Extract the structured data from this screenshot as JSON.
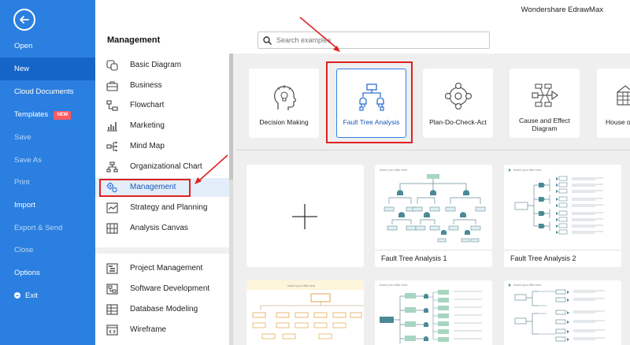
{
  "app": {
    "title": "Wondershare EdrawMax"
  },
  "menu": {
    "items": [
      {
        "label": "Open"
      },
      {
        "label": "New"
      },
      {
        "label": "Cloud Documents"
      },
      {
        "label": "Templates",
        "badge": "NEW"
      },
      {
        "label": "Save"
      },
      {
        "label": "Save As"
      },
      {
        "label": "Print"
      },
      {
        "label": "Import"
      },
      {
        "label": "Export & Send"
      },
      {
        "label": "Close"
      },
      {
        "label": "Options"
      },
      {
        "label": "Exit"
      }
    ]
  },
  "header": {
    "section_title": "Management"
  },
  "search": {
    "placeholder": "Search examples"
  },
  "categories": {
    "items": [
      {
        "label": "Basic Diagram",
        "icon": "basic-diagram-icon"
      },
      {
        "label": "Business",
        "icon": "briefcase-icon"
      },
      {
        "label": "Flowchart",
        "icon": "flowchart-icon"
      },
      {
        "label": "Marketing",
        "icon": "bar-chart-icon"
      },
      {
        "label": "Mind Map",
        "icon": "mind-map-icon"
      },
      {
        "label": "Organizational Chart",
        "icon": "org-chart-icon"
      },
      {
        "label": "Management",
        "icon": "management-gear-icon"
      },
      {
        "label": "Strategy and Planning",
        "icon": "strategy-icon"
      },
      {
        "label": "Analysis Canvas",
        "icon": "canvas-icon"
      },
      {
        "label": "Project Management",
        "icon": "gantt-icon"
      },
      {
        "label": "Software Development",
        "icon": "software-icon"
      },
      {
        "label": "Database Modeling",
        "icon": "database-icon"
      },
      {
        "label": "Wireframe",
        "icon": "wireframe-icon"
      }
    ]
  },
  "diagram_types": {
    "items": [
      {
        "label": "Decision Making",
        "icon": "head-bulb-icon"
      },
      {
        "label": "Fault Tree Analysis",
        "icon": "fault-tree-icon"
      },
      {
        "label": "Plan-Do-Check-Act",
        "icon": "pdca-cycle-icon"
      },
      {
        "label": "Cause and Effect Diagram",
        "icon": "fishbone-icon"
      },
      {
        "label": "House o",
        "icon": "house-of-quality-icon"
      }
    ]
  },
  "templates": {
    "items": [
      {
        "name": "Fault Tree Analysis 1",
        "thumb_title": "Insert your title here"
      },
      {
        "name": "Fault Tree Analysis 2",
        "thumb_title": "Insert your title here"
      },
      {
        "name": "",
        "thumb_title": "Insert your title here"
      },
      {
        "name": "",
        "thumb_title": "Insert your title here"
      },
      {
        "name": "",
        "thumb_title": "Insert your title here"
      }
    ]
  },
  "colors": {
    "menu_blue": "#2a7fe0",
    "selected_blue": "#3182e6",
    "annotation_red": "#e02020",
    "thumb_teal": "#4a8a96",
    "thumb_green": "#a8d5c0"
  }
}
